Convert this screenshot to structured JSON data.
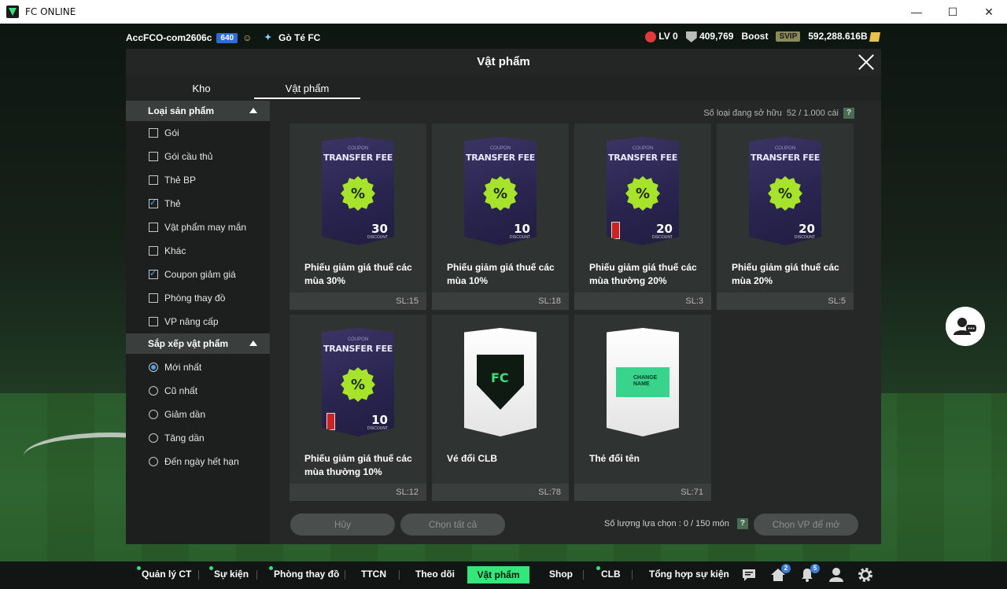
{
  "window": {
    "title": "FC ONLINE",
    "minimize": "—",
    "maximize": "☐",
    "close": "✕"
  },
  "topbar": {
    "account": "AccFCO-com2606c",
    "account_level": "640",
    "club_name": "Gò Té FC",
    "level": "LV 0",
    "trophies": "409,769",
    "boost_label": "Boost",
    "svip": "SVIP",
    "bp": "592,288.616B"
  },
  "modal": {
    "title": "Vật phẩm",
    "tabs": [
      {
        "label": "Kho"
      },
      {
        "label": "Vật phẩm"
      }
    ],
    "owned_label": "Số loại đang sở hữu",
    "owned_value": "52 / 1.000 cái",
    "help": "?",
    "filters": {
      "category_title": "Loại sản phẩm",
      "categories": [
        {
          "label": "Gói",
          "checked": false
        },
        {
          "label": "Gói cầu thủ",
          "checked": false
        },
        {
          "label": "Thẻ BP",
          "checked": false
        },
        {
          "label": "Thẻ",
          "checked": true
        },
        {
          "label": "Vật phẩm may mắn",
          "checked": false
        },
        {
          "label": "Khác",
          "checked": false
        },
        {
          "label": "Coupon giảm giá",
          "checked": true
        },
        {
          "label": "Phòng thay đồ",
          "checked": false
        },
        {
          "label": "VP nâng cấp",
          "checked": false
        }
      ],
      "sort_title": "Sắp xếp vật phẩm",
      "sorts": [
        {
          "label": "Mới nhất",
          "selected": true
        },
        {
          "label": "Cũ nhất",
          "selected": false
        },
        {
          "label": "Giảm dần",
          "selected": false
        },
        {
          "label": "Tăng dần",
          "selected": false
        },
        {
          "label": "Đến ngày hết hạn",
          "selected": false
        }
      ]
    },
    "items": [
      {
        "name": "Phiếu giảm giá thuế các mùa 30%",
        "qty": "SL:15",
        "kind": "coupon",
        "pct": "30",
        "locked": false
      },
      {
        "name": "Phiếu giảm giá thuế các mùa 10%",
        "qty": "SL:18",
        "kind": "coupon",
        "pct": "10",
        "locked": false
      },
      {
        "name": "Phiếu giảm giá thuế các mùa thường 20%",
        "qty": "SL:3",
        "kind": "coupon",
        "pct": "20",
        "locked": true
      },
      {
        "name": "Phiếu giảm giá thuế các mùa 20%",
        "qty": "SL:5",
        "kind": "coupon",
        "pct": "20",
        "locked": false
      },
      {
        "name": "Phiếu giảm giá thuế các mùa thường 10%",
        "qty": "SL:12",
        "kind": "coupon",
        "pct": "10",
        "locked": true
      },
      {
        "name": "Vé đổi CLB",
        "qty": "SL:78",
        "kind": "club",
        "pct": "",
        "locked": false
      },
      {
        "name": "Thẻ đổi tên",
        "qty": "SL:71",
        "kind": "rename",
        "pct": "",
        "locked": false
      }
    ],
    "coupon_small": "COUPON",
    "coupon_big": "TRANSFER FEE",
    "coupon_badge": "%",
    "discount_word": "DISCOUNT",
    "rename_text": "CHANGE NAME",
    "cancel_label": "Hủy",
    "select_all_label": "Chọn tất cả",
    "selected_count_label": "Số lượng lựa chọn : 0 / 150 món",
    "open_label": "Chọn VP để mở"
  },
  "bottom_nav": {
    "items": [
      "Quản lý CT",
      "Sự kiện",
      "Phòng thay đồ",
      "TTCN",
      "Theo dõi",
      "Vật phẩm",
      "Shop",
      "CLB",
      "Tổng hợp sự kiện"
    ],
    "home_badge": "2",
    "bell_badge": "5"
  }
}
